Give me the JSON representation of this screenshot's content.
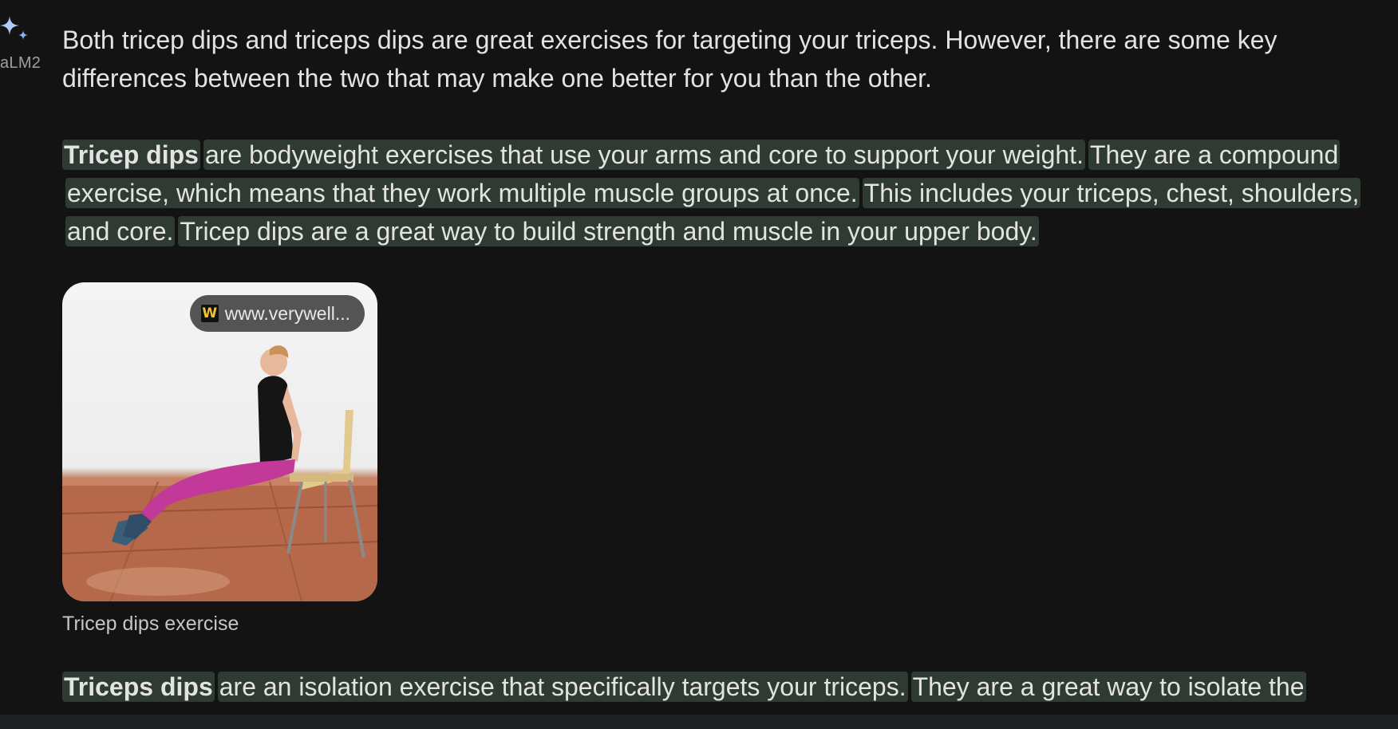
{
  "assistant": {
    "model_label": "aLM2",
    "icon": "sparkle-icon",
    "accent_color": "#8ab4f8"
  },
  "response": {
    "intro": "Both tricep dips and triceps dips are great exercises for targeting your triceps. However, there are some key differences between the two that may make one better for you than the other.",
    "para1": {
      "term": "Tricep dips",
      "s1": "are bodyweight exercises that use your arms and core to support your weight.",
      "s2": "They are a compound exercise, which means that they work multiple muscle groups at once.",
      "s3": "This includes your triceps, chest, shoulders, and core.",
      "s4": "Tricep dips are a great way to build strength and muscle in your upper body."
    },
    "image": {
      "source_label": "www.verywell...",
      "favicon_letter": "W",
      "caption": "Tricep dips exercise"
    },
    "para2": {
      "term": "Triceps dips",
      "s1": "are an isolation exercise that specifically targets your triceps.",
      "s2": "They are a great way to isolate the"
    }
  },
  "colors": {
    "background": "#131314",
    "highlight": "#2f3a33",
    "text": "#e3e3e3"
  }
}
